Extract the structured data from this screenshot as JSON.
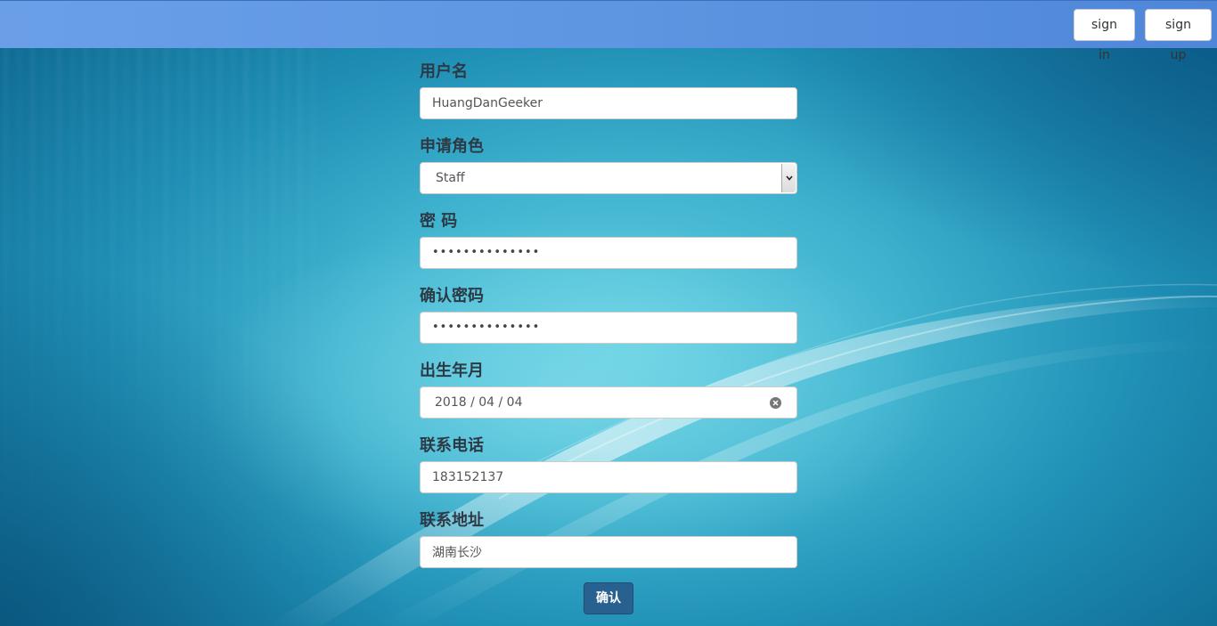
{
  "header": {
    "sign_in_label": "sign in",
    "sign_up_label": "sign up"
  },
  "form": {
    "username": {
      "label": "用户名",
      "value": "HuangDanGeeker"
    },
    "role": {
      "label": "申请角色",
      "selected": "Staff"
    },
    "password": {
      "label": "密 码",
      "value": "••••••••••••••"
    },
    "confirm_password": {
      "label": "确认密码",
      "value": "••••••••••••••"
    },
    "birth": {
      "label": "出生年月",
      "value": "2018 / 04 / 04"
    },
    "phone": {
      "label": "联系电话",
      "value": "183152137"
    },
    "address": {
      "label": "联系地址",
      "value": "湖南长沙"
    },
    "submit_label": "确认"
  },
  "colors": {
    "header": "#5e96e2",
    "primary_button": "#286090",
    "label_text": "#2d3a45"
  },
  "icons": {
    "select_arrow": "chevron-down-icon",
    "date_clear": "clear-circle-icon"
  }
}
